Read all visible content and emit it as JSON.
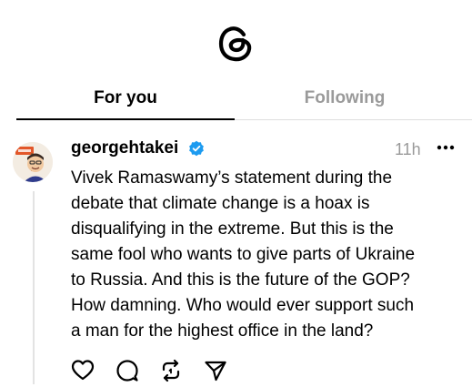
{
  "app": {
    "logo_icon": "threads-logo-icon"
  },
  "tabs": [
    {
      "label": "For you",
      "active": true
    },
    {
      "label": "Following",
      "active": false
    }
  ],
  "post": {
    "username": "georgehtakei",
    "verified": true,
    "verified_color": "#1d9bf0",
    "time": "11h",
    "text": "Vivek Ramaswamy’s statement during the\ndebate that climate change is a hoax is\ndisqualifying in the extreme. But this is the\nsame fool who wants to give parts of Ukraine\nto Russia. And this is the future of the GOP?\nHow damning. Who would ever support such\na man for the highest office in the land?",
    "actions": [
      "heart-icon",
      "comment-icon",
      "repost-icon",
      "share-icon"
    ]
  }
}
